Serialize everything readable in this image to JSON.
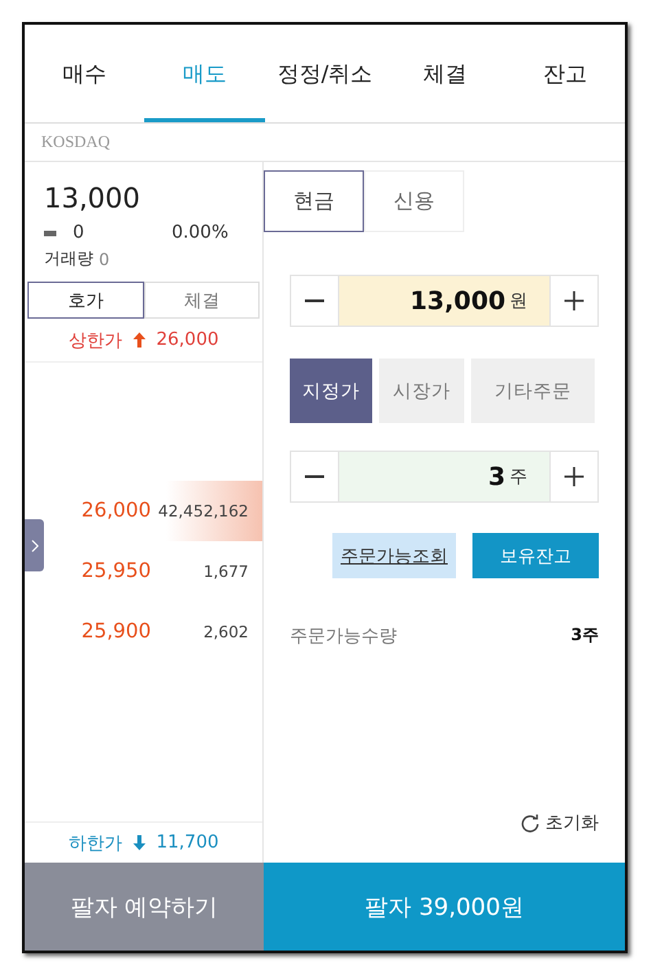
{
  "tabs": [
    {
      "label": "매수",
      "selected": false
    },
    {
      "label": "매도",
      "selected": true
    },
    {
      "label": "정정/취소",
      "selected": false
    },
    {
      "label": "체결",
      "selected": false
    },
    {
      "label": "잔고",
      "selected": false
    }
  ],
  "market": "KOSDAQ",
  "quote": {
    "price": "13,000",
    "change": "0",
    "rate": "0.00%",
    "volume_label": "거래량",
    "volume": "0"
  },
  "book_tabs": [
    {
      "label": "호가",
      "selected": true
    },
    {
      "label": "체결",
      "selected": false
    }
  ],
  "upper_limit": {
    "label": "상한가",
    "value": "26,000"
  },
  "asks": [
    {
      "price": "26,000",
      "volume": "42,452,162",
      "highlighted": true
    },
    {
      "price": "25,950",
      "volume": "1,677",
      "highlighted": false
    },
    {
      "price": "25,900",
      "volume": "2,602",
      "highlighted": false
    }
  ],
  "lower_limit": {
    "label": "하한가",
    "value": "11,700"
  },
  "credit_tabs": [
    {
      "label": "현금",
      "selected": true
    },
    {
      "label": "신용",
      "selected": false
    }
  ],
  "price_input": {
    "value": "13,000",
    "unit": "원"
  },
  "order_types": [
    {
      "label": "지정가",
      "selected": true
    },
    {
      "label": "시장가",
      "selected": false
    },
    {
      "label": "기타주문",
      "selected": false
    }
  ],
  "quantity_input": {
    "value": "3",
    "unit": "주"
  },
  "query_button": "주문가능조회",
  "holdings_button": "보유잔고",
  "available": {
    "label": "주문가능수량",
    "value": "3주"
  },
  "reset": "초기화",
  "reserve_button": "팔자 예약하기",
  "sell_button": "팔자 39,000원"
}
